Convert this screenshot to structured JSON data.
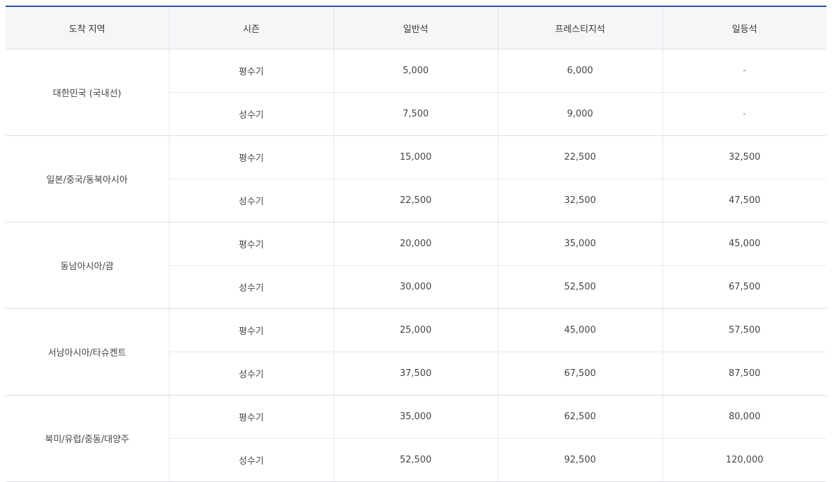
{
  "headers": {
    "region": "도착 지역",
    "season": "시즌",
    "economy": "일반석",
    "prestige": "프레스티지석",
    "first": "일등석"
  },
  "rows": [
    {
      "region": "대한민국 (국내선)",
      "off_peak": {
        "season": "평수기",
        "economy": "5,000",
        "prestige": "6,000",
        "first": "-"
      },
      "peak": {
        "season": "성수기",
        "economy": "7,500",
        "prestige": "9,000",
        "first": "-"
      }
    },
    {
      "region": "일본/중국/동북아시아",
      "off_peak": {
        "season": "평수기",
        "economy": "15,000",
        "prestige": "22,500",
        "first": "32,500"
      },
      "peak": {
        "season": "성수기",
        "economy": "22,500",
        "prestige": "32,500",
        "first": "47,500"
      }
    },
    {
      "region": "동남아시아/괌",
      "off_peak": {
        "season": "평수기",
        "economy": "20,000",
        "prestige": "35,000",
        "first": "45,000"
      },
      "peak": {
        "season": "성수기",
        "economy": "30,000",
        "prestige": "52,500",
        "first": "67,500"
      }
    },
    {
      "region": "서남아시아/타슈켄트",
      "off_peak": {
        "season": "평수기",
        "economy": "25,000",
        "prestige": "45,000",
        "first": "57,500"
      },
      "peak": {
        "season": "성수기",
        "economy": "37,500",
        "prestige": "67,500",
        "first": "87,500"
      }
    },
    {
      "region": "북미/유럽/중동/대양주",
      "off_peak": {
        "season": "평수기",
        "economy": "35,000",
        "prestige": "62,500",
        "first": "80,000"
      },
      "peak": {
        "season": "성수기",
        "economy": "52,500",
        "prestige": "92,500",
        "first": "120,000"
      }
    }
  ]
}
